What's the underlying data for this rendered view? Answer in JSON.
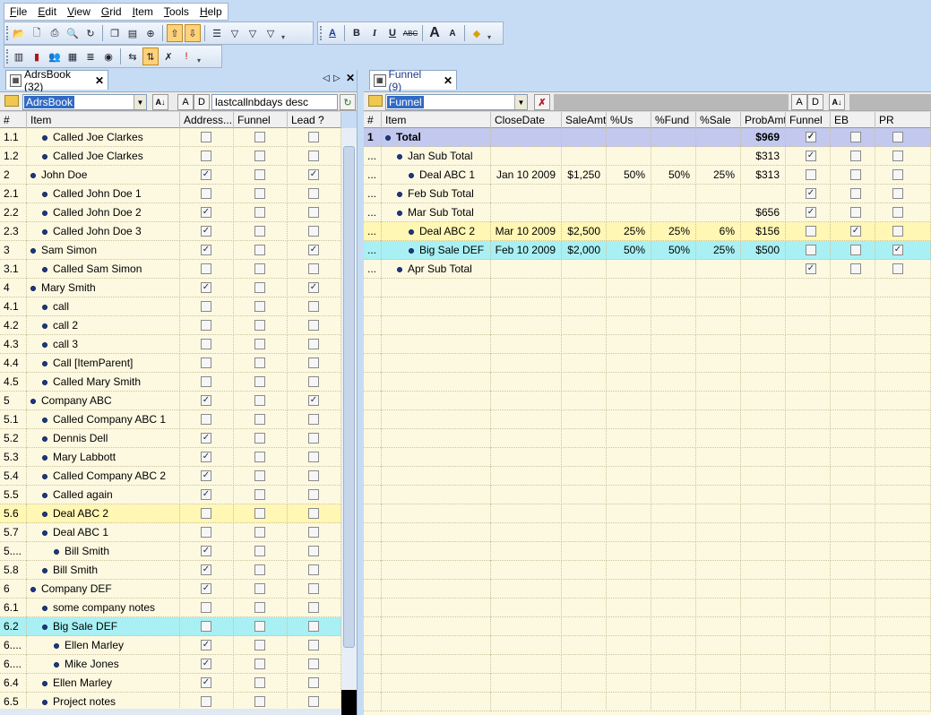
{
  "menu": [
    "File",
    "Edit",
    "View",
    "Grid",
    "Item",
    "Tools",
    "Help"
  ],
  "toolbar1_icons": [
    "open-icon",
    "print-preview-icon",
    "print-icon",
    "find-icon",
    "refresh-icon",
    "copy-icon",
    "properties-icon",
    "zoom-icon",
    "move-up-icon",
    "move-down-icon",
    "outline-icon",
    "filter-a-icon",
    "filter-d-icon",
    "filter-c-icon"
  ],
  "format_toolbar": {
    "font_icon": "font-icon",
    "bold": "B",
    "italic": "I",
    "underline": "U",
    "strike": "ABC",
    "grow": "A",
    "shrink": "A",
    "fill_icon": "fill-color-icon"
  },
  "toolbar2_icons": [
    "layout-icon",
    "chart-icon",
    "people-icon",
    "calendar-icon",
    "list-icon",
    "globe-icon",
    "split-icon",
    "sort-icon",
    "delete-icon",
    "priority-icon"
  ],
  "left": {
    "tab_label": "AdrsBook (32)",
    "view_select": "AdrsBook",
    "sort_field": "lastcallnbdays desc",
    "btn_a": "A",
    "btn_d": "D",
    "columns": [
      "#",
      "Item",
      "Address...",
      "Funnel",
      "Lead ?"
    ],
    "rows": [
      {
        "num": "1.1",
        "item": "Called Joe Clarkes",
        "level": 1,
        "c": [
          false,
          false,
          false
        ]
      },
      {
        "num": "1.2",
        "item": "Called Joe Clarkes",
        "level": 1,
        "c": [
          false,
          false,
          false
        ]
      },
      {
        "num": "2",
        "item": "John Doe",
        "level": 0,
        "c": [
          true,
          false,
          true
        ]
      },
      {
        "num": "2.1",
        "item": "Called John Doe 1",
        "level": 1,
        "c": [
          false,
          false,
          false
        ]
      },
      {
        "num": "2.2",
        "item": "Called John Doe 2",
        "level": 1,
        "c": [
          true,
          false,
          false
        ]
      },
      {
        "num": "2.3",
        "item": "Called John Doe 3",
        "level": 1,
        "c": [
          true,
          false,
          false
        ]
      },
      {
        "num": "3",
        "item": "Sam Simon",
        "level": 0,
        "c": [
          true,
          false,
          true
        ]
      },
      {
        "num": "3.1",
        "item": "Called Sam Simon",
        "level": 1,
        "c": [
          false,
          false,
          false
        ]
      },
      {
        "num": "4",
        "item": "Mary Smith",
        "level": 0,
        "c": [
          true,
          false,
          true
        ]
      },
      {
        "num": "4.1",
        "item": "call",
        "level": 1,
        "c": [
          false,
          false,
          false
        ]
      },
      {
        "num": "4.2",
        "item": "call 2",
        "level": 1,
        "c": [
          false,
          false,
          false
        ]
      },
      {
        "num": "4.3",
        "item": "call 3",
        "level": 1,
        "c": [
          false,
          false,
          false
        ]
      },
      {
        "num": "4.4",
        "item": "Call [ItemParent]",
        "level": 1,
        "c": [
          false,
          false,
          false
        ]
      },
      {
        "num": "4.5",
        "item": "Called Mary Smith",
        "level": 1,
        "c": [
          false,
          false,
          false
        ]
      },
      {
        "num": "5",
        "item": "Company ABC",
        "level": 0,
        "c": [
          true,
          false,
          true
        ]
      },
      {
        "num": "5.1",
        "item": "Called Company ABC 1",
        "level": 1,
        "c": [
          false,
          false,
          false
        ]
      },
      {
        "num": "5.2",
        "item": "Dennis Dell",
        "level": 1,
        "c": [
          true,
          false,
          false
        ]
      },
      {
        "num": "5.3",
        "item": "Mary Labbott",
        "level": 1,
        "c": [
          true,
          false,
          false
        ]
      },
      {
        "num": "5.4",
        "item": "Called Company ABC 2",
        "level": 1,
        "c": [
          true,
          false,
          false
        ]
      },
      {
        "num": "5.5",
        "item": "Called again",
        "level": 1,
        "c": [
          true,
          false,
          false
        ]
      },
      {
        "num": "5.6",
        "item": "Deal ABC 2",
        "level": 1,
        "c": [
          false,
          false,
          false
        ],
        "hl": "#fff7b3"
      },
      {
        "num": "5.7",
        "item": "Deal ABC 1",
        "level": 1,
        "c": [
          false,
          false,
          false
        ]
      },
      {
        "num": "5....",
        "item": "Bill Smith",
        "level": 2,
        "c": [
          true,
          false,
          false
        ]
      },
      {
        "num": "5.8",
        "item": "Bill Smith",
        "level": 1,
        "c": [
          true,
          false,
          false
        ]
      },
      {
        "num": "6",
        "item": "Company DEF",
        "level": 0,
        "c": [
          true,
          false,
          false
        ]
      },
      {
        "num": "6.1",
        "item": "some company notes",
        "level": 1,
        "c": [
          false,
          false,
          false
        ]
      },
      {
        "num": "6.2",
        "item": "Big Sale DEF",
        "level": 1,
        "c": [
          false,
          false,
          false
        ],
        "hl": "#a8f0f4"
      },
      {
        "num": "6....",
        "item": "Ellen Marley",
        "level": 2,
        "c": [
          true,
          false,
          false
        ]
      },
      {
        "num": "6....",
        "item": "Mike Jones",
        "level": 2,
        "c": [
          true,
          false,
          false
        ]
      },
      {
        "num": "6.4",
        "item": "Ellen Marley",
        "level": 1,
        "c": [
          true,
          false,
          false
        ]
      },
      {
        "num": "6.5",
        "item": "Project notes",
        "level": 1,
        "c": [
          false,
          false,
          false
        ]
      }
    ]
  },
  "right": {
    "tab_label": "Funnel (9)",
    "view_select": "Funnel",
    "btn_a": "A",
    "btn_d": "D",
    "columns": [
      "#",
      "Item",
      "CloseDate",
      "SaleAmt",
      "%Us",
      "%Fund",
      "%Sale",
      "ProbAmt",
      "Funnel",
      "EB",
      "PR"
    ],
    "rows": [
      {
        "num": "1",
        "item": "Total",
        "level": 0,
        "close": "",
        "sale": "",
        "us": "",
        "fund": "",
        "psale": "",
        "prob": "$969",
        "c": [
          true,
          false,
          false
        ],
        "hl": "#c2c8ee",
        "bold": true
      },
      {
        "num": "...",
        "item": "Jan Sub Total",
        "level": 1,
        "close": "",
        "sale": "",
        "us": "",
        "fund": "",
        "psale": "",
        "prob": "$313",
        "c": [
          true,
          false,
          false
        ]
      },
      {
        "num": "...",
        "item": "Deal ABC 1",
        "level": 2,
        "close": "Jan 10 2009",
        "sale": "$1,250",
        "us": "50%",
        "fund": "50%",
        "psale": "25%",
        "prob": "$313",
        "c": [
          false,
          false,
          false
        ]
      },
      {
        "num": "...",
        "item": "Feb Sub Total",
        "level": 1,
        "close": "",
        "sale": "",
        "us": "",
        "fund": "",
        "psale": "",
        "prob": "",
        "c": [
          true,
          false,
          false
        ]
      },
      {
        "num": "...",
        "item": "Mar Sub Total",
        "level": 1,
        "close": "",
        "sale": "",
        "us": "",
        "fund": "",
        "psale": "",
        "prob": "$656",
        "c": [
          true,
          false,
          false
        ]
      },
      {
        "num": "...",
        "item": "Deal ABC 2",
        "level": 2,
        "close": "Mar 10 2009",
        "sale": "$2,500",
        "us": "25%",
        "fund": "25%",
        "psale": "6%",
        "prob": "$156",
        "c": [
          false,
          true,
          false
        ],
        "hl": "#fff7b3"
      },
      {
        "num": "...",
        "item": "Big Sale DEF",
        "level": 2,
        "close": "Feb 10 2009",
        "sale": "$2,000",
        "us": "50%",
        "fund": "50%",
        "psale": "25%",
        "prob": "$500",
        "c": [
          false,
          false,
          true
        ],
        "hl": "#a8f0f4"
      },
      {
        "num": "...",
        "item": "Apr Sub Total",
        "level": 1,
        "close": "",
        "sale": "",
        "us": "",
        "fund": "",
        "psale": "",
        "prob": "",
        "c": [
          true,
          false,
          false
        ]
      }
    ]
  }
}
